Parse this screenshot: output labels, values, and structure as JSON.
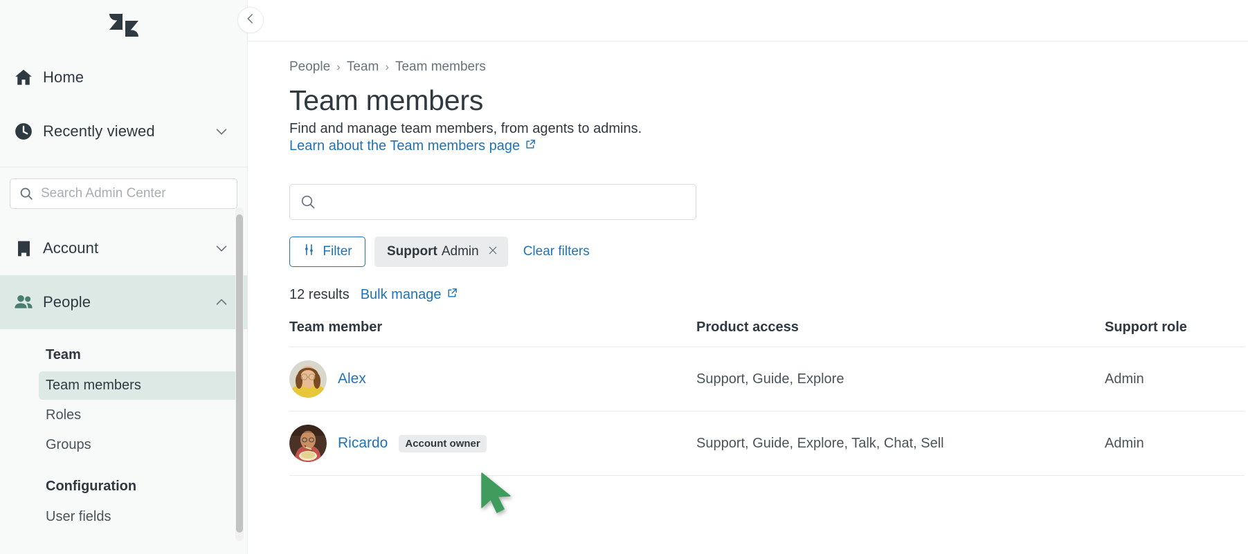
{
  "sidebar": {
    "logo_alt": "zendesk-logo",
    "top_items": [
      {
        "label": "Home",
        "icon": "home-icon",
        "has_chevron": false
      },
      {
        "label": "Recently viewed",
        "icon": "clock-icon",
        "has_chevron": true,
        "chevron": "down"
      }
    ],
    "search": {
      "placeholder": "Search Admin Center",
      "value": "",
      "icon": "search-icon"
    },
    "sections": [
      {
        "label": "Account",
        "icon": "building-icon",
        "chevron": "down",
        "selected": false
      },
      {
        "label": "People",
        "icon": "people-icon",
        "chevron": "up",
        "selected": true
      }
    ],
    "subnav": [
      {
        "type": "heading",
        "label": "Team"
      },
      {
        "type": "item",
        "label": "Team members",
        "active": true
      },
      {
        "type": "item",
        "label": "Roles",
        "active": false
      },
      {
        "type": "item",
        "label": "Groups",
        "active": false
      },
      {
        "type": "gap"
      },
      {
        "type": "heading",
        "label": "Configuration"
      },
      {
        "type": "item",
        "label": "User fields",
        "active": false
      }
    ],
    "collapse_icon": "chevron-left-icon"
  },
  "breadcrumb": {
    "items": [
      "People",
      "Team",
      "Team members"
    ],
    "separator": "›"
  },
  "page": {
    "title": "Team members",
    "subtitle": "Find and manage team members, from agents to admins.",
    "learn_link": "Learn about the Team members page",
    "external_icon": "external-link-icon"
  },
  "search": {
    "placeholder": "",
    "value": "",
    "icon": "search-icon"
  },
  "filters": {
    "filter_button": "Filter",
    "filter_icon": "sliders-icon",
    "chip": {
      "label": "Support",
      "value": "Admin",
      "remove_icon": "close-icon"
    },
    "clear": "Clear filters"
  },
  "results": {
    "count_text": "12 results",
    "bulk_manage": "Bulk manage",
    "bulk_icon": "external-link-icon"
  },
  "table": {
    "columns": [
      "Team member",
      "Product access",
      "Support role"
    ],
    "rows": [
      {
        "name": "Alex",
        "badge": "",
        "avatar": "avatar-alex",
        "product_access": "Support, Guide, Explore",
        "support_role": "Admin"
      },
      {
        "name": "Ricardo",
        "badge": "Account owner",
        "avatar": "avatar-ricardo",
        "product_access": "Support, Guide, Explore, Talk, Chat, Sell",
        "support_role": "Admin"
      }
    ]
  },
  "cursor": {
    "icon": "mouse-pointer-green",
    "color": "#3f9c5c"
  },
  "colors": {
    "accent_link": "#1f73b7",
    "selected_bg": "#dce9e5",
    "text": "#2f3941",
    "muted": "#68737d",
    "border": "#e9ebed",
    "cursor_green": "#3f9c5c"
  }
}
